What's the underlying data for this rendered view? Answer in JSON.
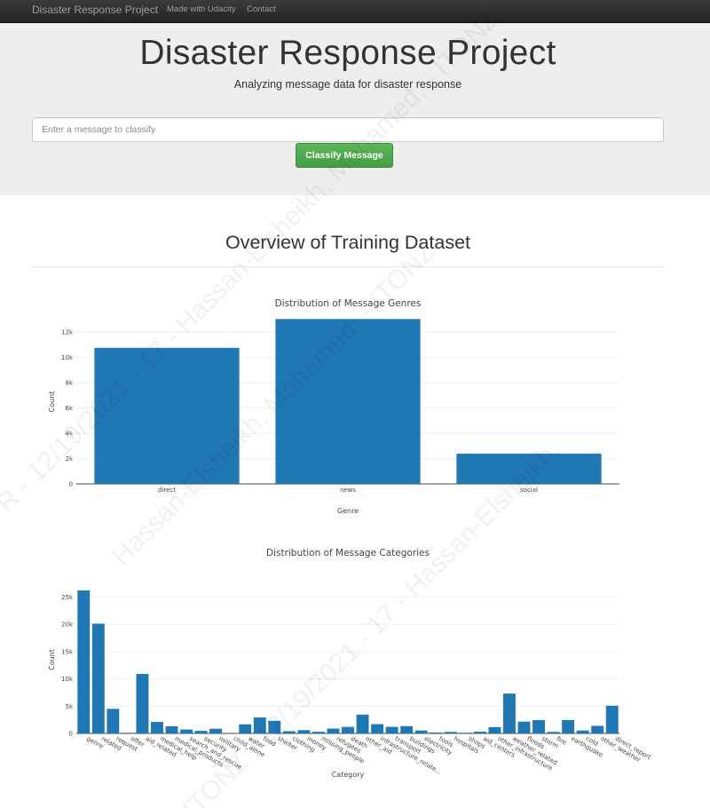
{
  "navbar": {
    "brand": "Disaster Response Project",
    "links": [
      "Made with Udacity",
      "Contact"
    ]
  },
  "header": {
    "title": "Disaster Response Project",
    "subtitle": "Analyzing message data for disaster response"
  },
  "search": {
    "placeholder": "Enter a message to classify",
    "value": ""
  },
  "classify_button": "Classify Message",
  "overview_title": "Overview of Training Dataset",
  "watermark": {
    "text_a": "Hassan-Elsheikh, Mohamed, - ITONZ",
    "text_b": "R - 12/19/2021 - 17 - Hassan-Elsheikh, Mohamed, - ITONZ",
    "text_c": "ITONZ - 12/19/2021 - 17 - Hassan-Elsheikh,"
  },
  "colors": {
    "bar": "#1f77b4",
    "navbar": "#222222",
    "jumbotron": "#eeeeee",
    "button": "#5cb85c"
  },
  "chart_data": [
    {
      "type": "bar",
      "title": "Distribution of Message Genres",
      "xlabel": "Genre",
      "ylabel": "Count",
      "categories": [
        "direct",
        "news",
        "social"
      ],
      "values": [
        10770,
        13050,
        2400
      ],
      "ylim": [
        0,
        13000
      ],
      "yticks": [
        0,
        2000,
        4000,
        6000,
        8000,
        10000,
        12000
      ],
      "ytick_labels": [
        "0",
        "2k",
        "4k",
        "6k",
        "8k",
        "10k",
        "12k"
      ],
      "grid": true
    },
    {
      "type": "bar",
      "title": "Distribution of Message Categories",
      "xlabel": "Category",
      "ylabel": "Count",
      "categories": [
        "genre",
        "related",
        "request",
        "offer",
        "aid_related",
        "medical_help",
        "medical_products",
        "search_and_rescue",
        "security",
        "military",
        "child_alone",
        "water",
        "food",
        "shelter",
        "clothing",
        "money",
        "missing_people",
        "refugees",
        "death",
        "other_aid",
        "infrastructure_related",
        "transport",
        "buildings",
        "electricity",
        "tools",
        "hospitals",
        "shops",
        "aid_centers",
        "other_infrastructure",
        "weather_related",
        "floods",
        "storm",
        "fire",
        "earthquake",
        "cold",
        "other_weather",
        "direct_report"
      ],
      "category_labels": [
        "genre",
        "related",
        "request",
        "offer",
        "aid_related",
        "medical_help",
        "medical_products",
        "search_and_rescue",
        "security",
        "military",
        "child_alone",
        "water",
        "food",
        "shelter",
        "clothing",
        "money",
        "missing_people",
        "refugees",
        "death",
        "other_aid",
        "infrastructure_relate...",
        "transport",
        "buildings",
        "electricity",
        "tools",
        "hospitals",
        "shops",
        "aid_centers",
        "other_infrastructure",
        "weather_related",
        "floods",
        "storm",
        "fire",
        "earthquake",
        "cold",
        "other_weather",
        "direct_report"
      ],
      "values": [
        26200,
        20100,
        4500,
        120,
        10900,
        2100,
        1300,
        720,
        470,
        860,
        0,
        1670,
        2920,
        2310,
        400,
        600,
        300,
        880,
        1190,
        3450,
        1700,
        1200,
        1330,
        530,
        160,
        280,
        120,
        310,
        1150,
        7300,
        2160,
        2440,
        280,
        2450,
        530,
        1380,
        5080
      ],
      "ylim": [
        0,
        27000
      ],
      "yticks": [
        0,
        5000,
        10000,
        15000,
        20000,
        25000
      ],
      "ytick_labels": [
        "0",
        "5k",
        "10k",
        "15k",
        "20k",
        "25k"
      ],
      "grid": true
    }
  ]
}
